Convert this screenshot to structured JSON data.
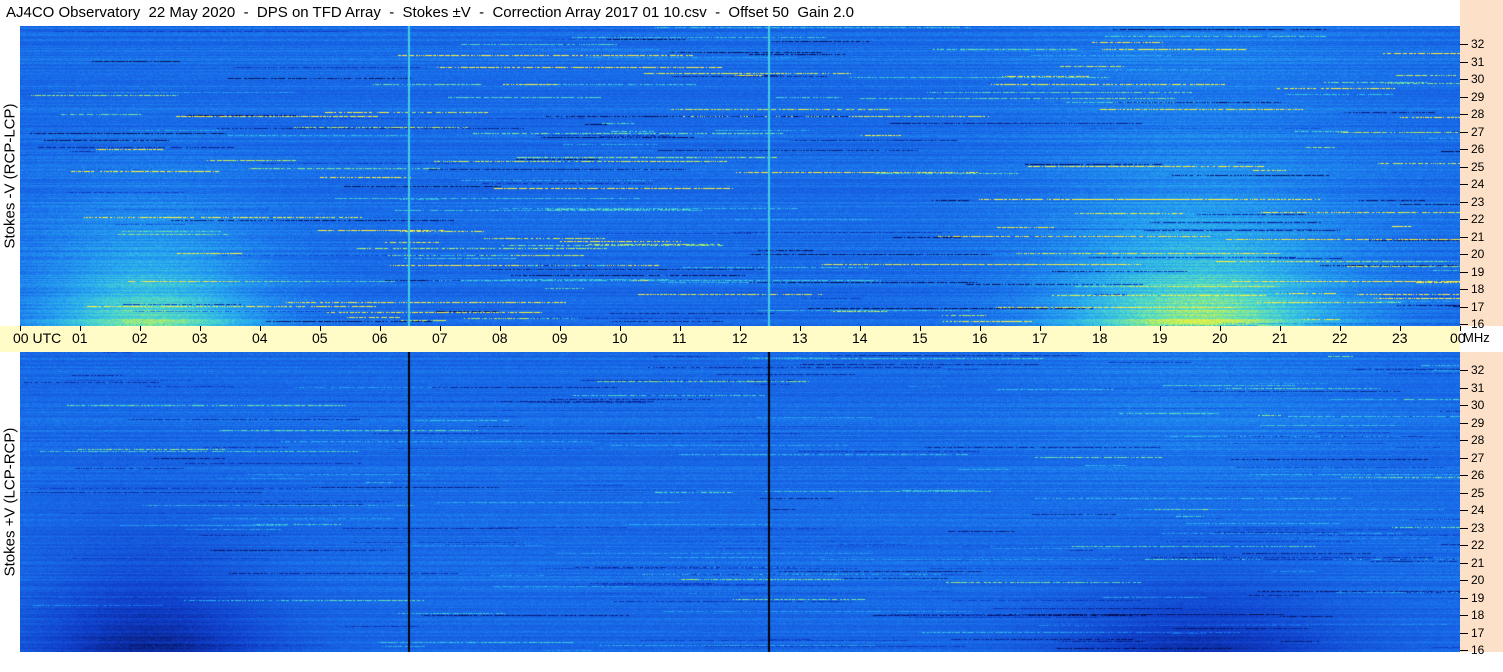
{
  "title": "AJ4CO Observatory  22 May 2020  -  DPS on TFD Array  -  Stokes ±V  -  Correction Array 2017 01 10.csv  -  Offset 50  Gain 2.0",
  "panels": {
    "top": {
      "label": "Stokes -V (RCP-LCP)"
    },
    "bottom": {
      "label": "Stokes +V (LCP-RCP)"
    }
  },
  "time_axis": {
    "labels": [
      "00 UTC",
      "01",
      "02",
      "03",
      "04",
      "05",
      "06",
      "07",
      "08",
      "09",
      "10",
      "11",
      "12",
      "13",
      "14",
      "15",
      "16",
      "17",
      "18",
      "19",
      "20",
      "21",
      "22",
      "23",
      "00"
    ],
    "unit": "MHz"
  },
  "freq_axis": {
    "labels": [
      "32",
      "31",
      "30",
      "29",
      "28",
      "27",
      "26",
      "25",
      "24",
      "23",
      "22",
      "21",
      "20",
      "19",
      "18",
      "17",
      "16"
    ]
  },
  "colors": {
    "background": "#1a5ad8",
    "time_bar": "#fffcc8",
    "freq_bar": "#fce0c8",
    "cursor_top": "#40d0e0",
    "cursor_bottom": "#000000"
  }
}
